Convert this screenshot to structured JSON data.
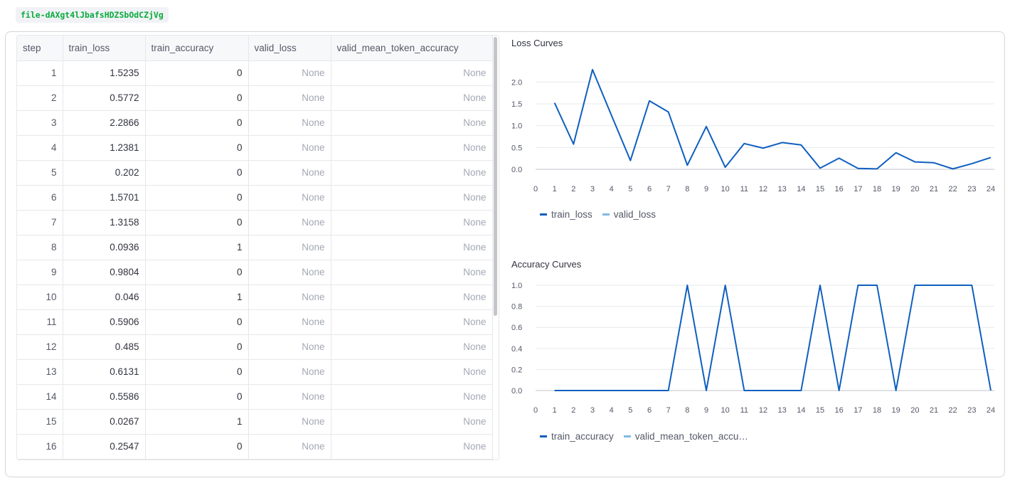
{
  "file_id": "file-dAXgt4lJbafsHDZSbOdCZjVg",
  "table": {
    "columns": [
      "step",
      "train_loss",
      "train_accuracy",
      "valid_loss",
      "valid_mean_token_accuracy"
    ],
    "rows": [
      [
        "1",
        "1.5235",
        "0",
        "None",
        "None"
      ],
      [
        "2",
        "0.5772",
        "0",
        "None",
        "None"
      ],
      [
        "3",
        "2.2866",
        "0",
        "None",
        "None"
      ],
      [
        "4",
        "1.2381",
        "0",
        "None",
        "None"
      ],
      [
        "5",
        "0.202",
        "0",
        "None",
        "None"
      ],
      [
        "6",
        "1.5701",
        "0",
        "None",
        "None"
      ],
      [
        "7",
        "1.3158",
        "0",
        "None",
        "None"
      ],
      [
        "8",
        "0.0936",
        "1",
        "None",
        "None"
      ],
      [
        "9",
        "0.9804",
        "0",
        "None",
        "None"
      ],
      [
        "10",
        "0.046",
        "1",
        "None",
        "None"
      ],
      [
        "11",
        "0.5906",
        "0",
        "None",
        "None"
      ],
      [
        "12",
        "0.485",
        "0",
        "None",
        "None"
      ],
      [
        "13",
        "0.6131",
        "0",
        "None",
        "None"
      ],
      [
        "14",
        "0.5586",
        "0",
        "None",
        "None"
      ],
      [
        "15",
        "0.0267",
        "1",
        "None",
        "None"
      ],
      [
        "16",
        "0.2547",
        "0",
        "None",
        "None"
      ]
    ]
  },
  "colors": {
    "series_dark": "#0f5fbf",
    "series_light": "#7fbbea"
  },
  "chart_data": [
    {
      "type": "line",
      "title": "Loss Curves",
      "xlabel": "",
      "ylabel": "",
      "x": [
        1,
        2,
        3,
        4,
        5,
        6,
        7,
        8,
        9,
        10,
        11,
        12,
        13,
        14,
        15,
        16,
        17,
        18,
        19,
        20,
        21,
        22,
        23,
        24
      ],
      "x_ticks": [
        "0",
        "1",
        "2",
        "3",
        "4",
        "5",
        "6",
        "7",
        "8",
        "9",
        "10",
        "11",
        "12",
        "13",
        "14",
        "15",
        "16",
        "17",
        "18",
        "19",
        "20",
        "21",
        "22",
        "23",
        "24"
      ],
      "y_ticks": [
        "0.0",
        "0.5",
        "1.0",
        "1.5",
        "2.0"
      ],
      "xlim": [
        0,
        24
      ],
      "ylim": [
        0,
        2.3
      ],
      "grid": true,
      "legend_position": "bottom",
      "series": [
        {
          "name": "train_loss",
          "values": [
            1.5235,
            0.5772,
            2.2866,
            1.2381,
            0.202,
            1.5701,
            1.3158,
            0.0936,
            0.9804,
            0.046,
            0.5906,
            0.485,
            0.6131,
            0.5586,
            0.0267,
            0.2547,
            0.02,
            0.01,
            0.38,
            0.17,
            0.15,
            0.01,
            0.13,
            0.27
          ]
        },
        {
          "name": "valid_loss",
          "values": []
        }
      ]
    },
    {
      "type": "line",
      "title": "Accuracy Curves",
      "xlabel": "",
      "ylabel": "",
      "x": [
        1,
        2,
        3,
        4,
        5,
        6,
        7,
        8,
        9,
        10,
        11,
        12,
        13,
        14,
        15,
        16,
        17,
        18,
        19,
        20,
        21,
        22,
        23,
        24
      ],
      "x_ticks": [
        "0",
        "1",
        "2",
        "3",
        "4",
        "5",
        "6",
        "7",
        "8",
        "9",
        "10",
        "11",
        "12",
        "13",
        "14",
        "15",
        "16",
        "17",
        "18",
        "19",
        "20",
        "21",
        "22",
        "23",
        "24"
      ],
      "y_ticks": [
        "0.0",
        "0.2",
        "0.4",
        "0.6",
        "0.8",
        "1.0"
      ],
      "xlim": [
        0,
        24
      ],
      "ylim": [
        0,
        1
      ],
      "grid": true,
      "legend_position": "bottom",
      "series": [
        {
          "name": "train_accuracy",
          "values": [
            0,
            0,
            0,
            0,
            0,
            0,
            0,
            1,
            0,
            1,
            0,
            0,
            0,
            0,
            1,
            0,
            1,
            1,
            0,
            1,
            1,
            1,
            1,
            0
          ]
        },
        {
          "name": "valid_mean_token_accu…",
          "values": []
        }
      ]
    }
  ]
}
